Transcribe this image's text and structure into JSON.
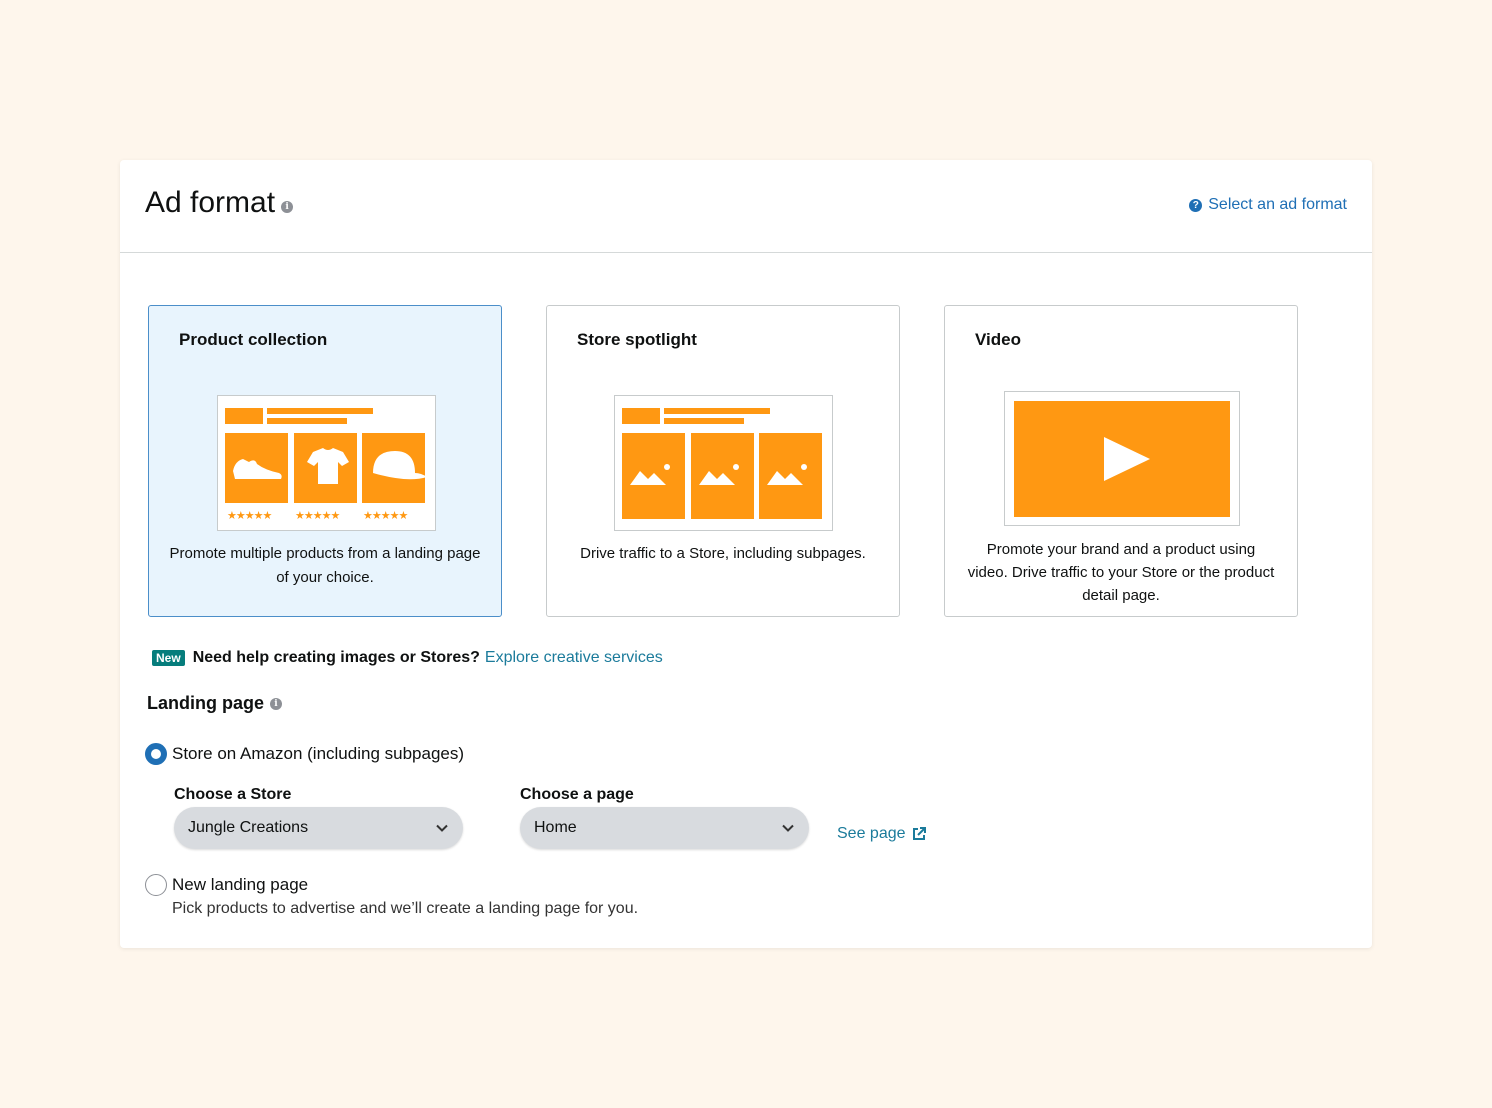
{
  "header": {
    "title": "Ad format",
    "help_link": "Select an ad format"
  },
  "cards": [
    {
      "title": "Product collection",
      "description": "Promote multiple products from a landing page of your choice.",
      "selected": true
    },
    {
      "title": "Store spotlight",
      "description": "Drive traffic to a Store, including subpages.",
      "selected": false
    },
    {
      "title": "Video",
      "description": "Promote your brand and a product using video. Drive traffic to your Store or the product detail page.",
      "selected": false
    }
  ],
  "promo": {
    "badge": "New",
    "text": "Need help creating images or Stores?",
    "link": "Explore creative services"
  },
  "landing_page": {
    "title": "Landing page",
    "options": [
      {
        "label": "Store on Amazon (including subpages)",
        "checked": true
      },
      {
        "label": "New landing page",
        "checked": false,
        "subtext": "Pick products to advertise and we’ll create a landing page for you."
      }
    ],
    "store_label": "Choose a Store",
    "store_value": "Jungle Creations",
    "page_label": "Choose a page",
    "page_value": "Home",
    "see_page": "See page"
  },
  "colors": {
    "accent_orange": "#ff9812",
    "link_blue": "#1f6fb5",
    "selected_bg": "#e8f4fd"
  }
}
